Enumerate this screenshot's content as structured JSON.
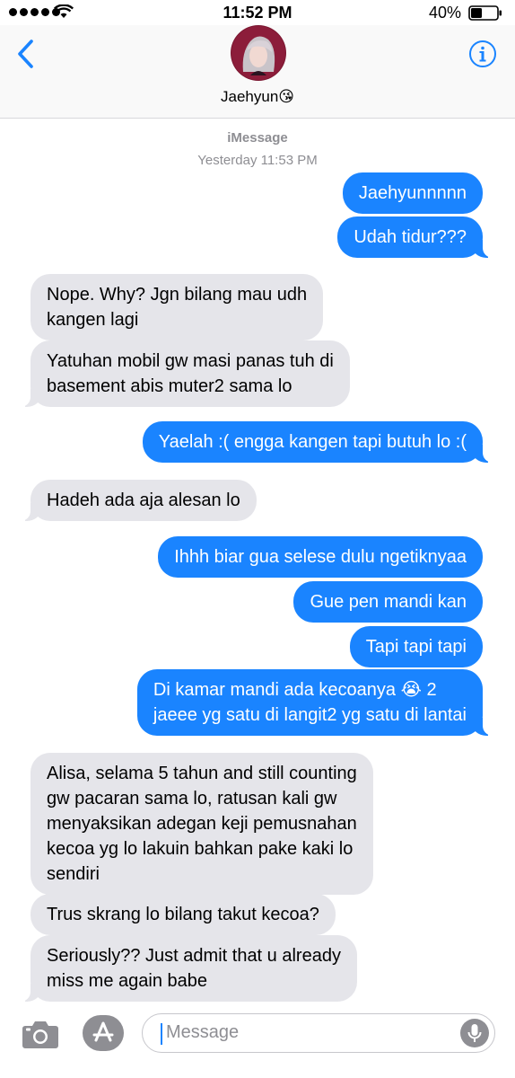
{
  "status_bar": {
    "time": "11:52 PM",
    "battery": "40%",
    "signal_icon": "signal-dots-icon",
    "wifi_icon": "wifi-icon",
    "battery_icon": "battery-icon"
  },
  "header": {
    "back_icon": "chevron-left-icon",
    "contact_name": "Jaehyun😘",
    "info_icon": "info-icon",
    "accent_color": "#1a84ff"
  },
  "conversation": {
    "service": "iMessage",
    "timestamp": "Yesterday 11:53 PM",
    "messages": [
      {
        "from": "me",
        "text": "Jaehyunnnnn"
      },
      {
        "from": "me",
        "text": "Udah tidur???"
      },
      {
        "from": "them",
        "lines": [
          "Nope. Why? Jgn bilang mau udh",
          "kangen lagi"
        ]
      },
      {
        "from": "them",
        "lines": [
          "Yatuhan mobil gw masi panas tuh di",
          "basement abis muter2 sama lo"
        ]
      },
      {
        "from": "me",
        "text": "Yaelah :( engga kangen tapi butuh lo :("
      },
      {
        "from": "them",
        "text": "Hadeh ada aja alesan lo"
      },
      {
        "from": "me",
        "text": "Ihhh biar gua selese dulu ngetiknyaa"
      },
      {
        "from": "me",
        "text": "Gue pen mandi kan"
      },
      {
        "from": "me",
        "text": "Tapi tapi tapi"
      },
      {
        "from": "me",
        "lines": [
          "Di kamar mandi ada kecoanya 😭 2",
          "jaeee yg satu di langit2 yg satu di lantai"
        ]
      },
      {
        "from": "them",
        "lines": [
          "Alisa, selama 5 tahun and still counting",
          "gw pacaran sama lo, ratusan kali gw",
          "menyaksikan adegan keji pemusnahan",
          "kecoa yg lo lakuin bahkan pake kaki lo",
          "sendiri"
        ]
      },
      {
        "from": "them",
        "text": "Trus skrang lo bilang takut kecoa?"
      },
      {
        "from": "them",
        "lines": [
          "Seriously?? Just admit that u already",
          "miss me again babe"
        ]
      }
    ]
  },
  "input_bar": {
    "placeholder": "Message",
    "camera_icon": "camera-icon",
    "apps_icon": "app-store-icon",
    "mic_icon": "microphone-icon"
  }
}
